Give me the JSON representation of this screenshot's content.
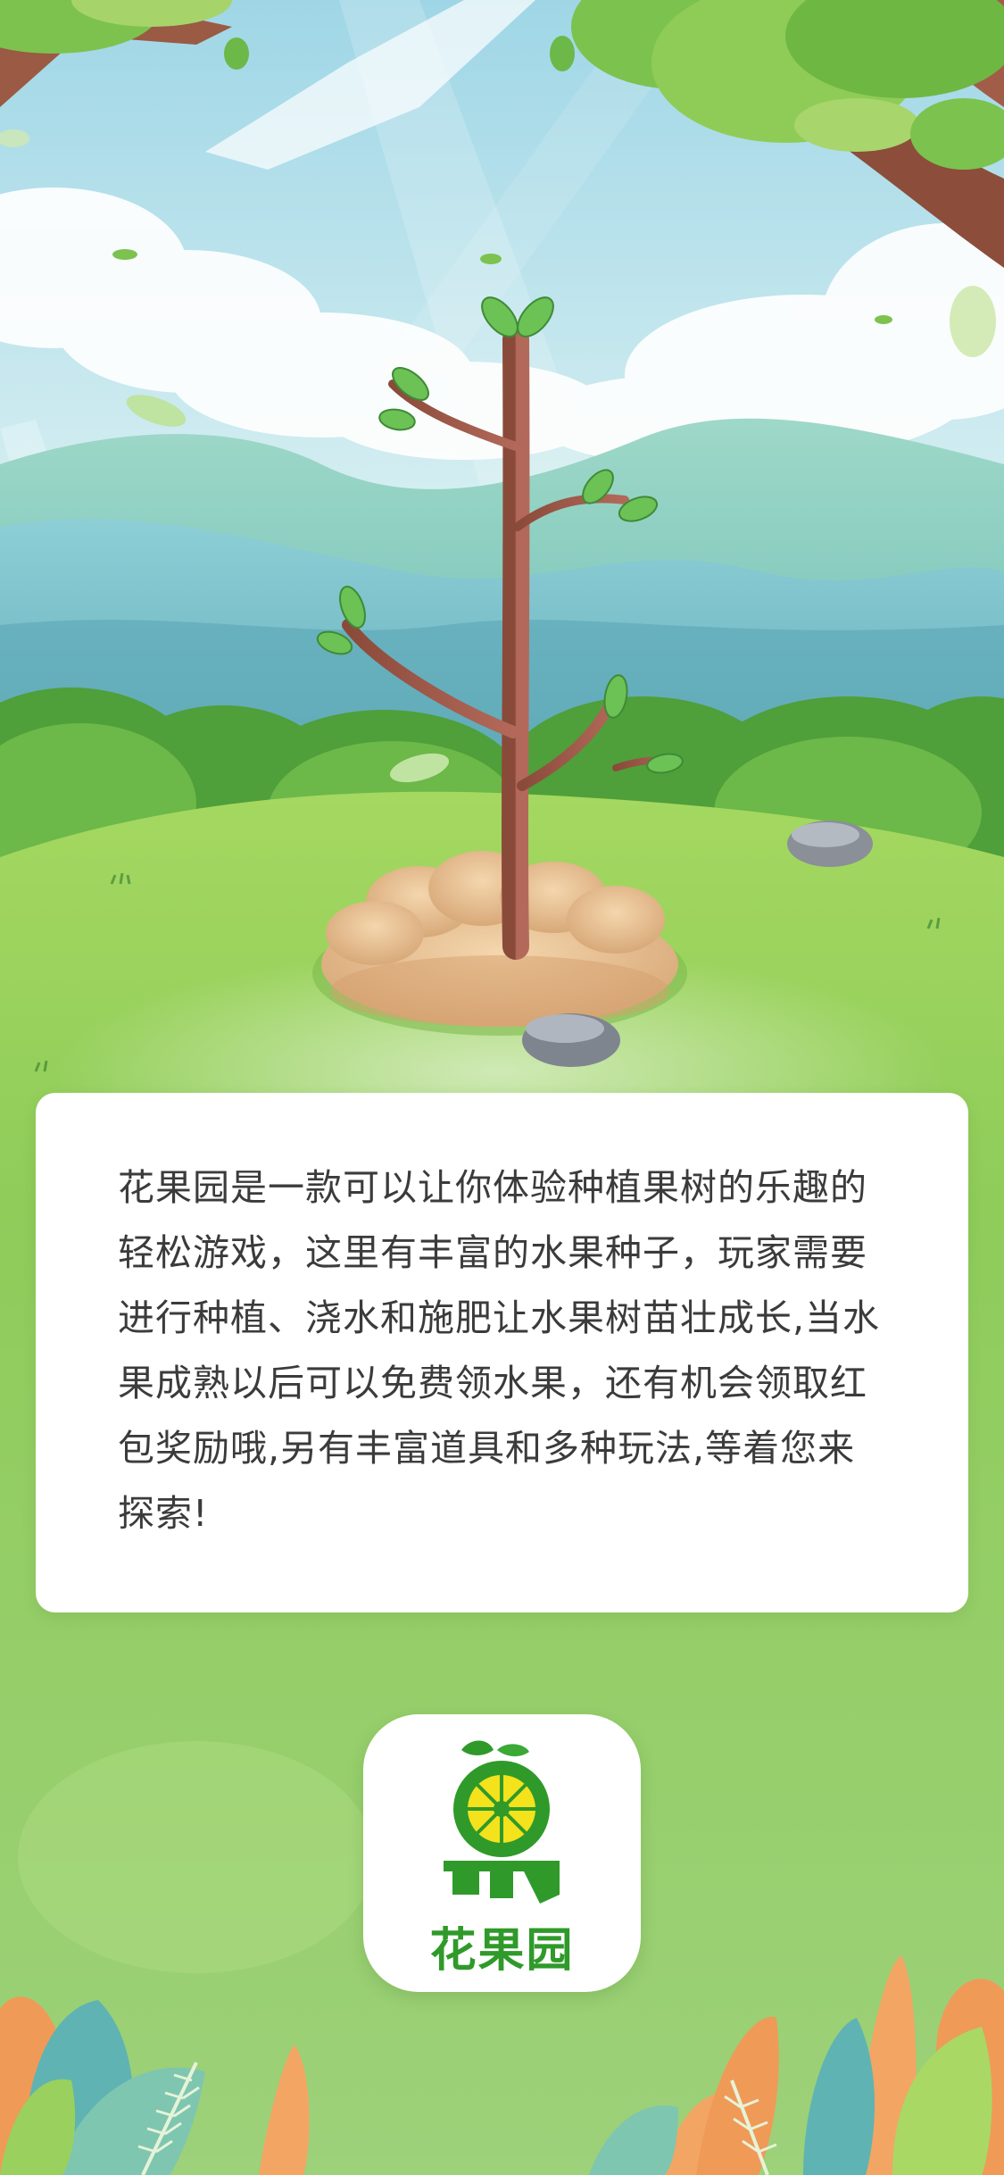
{
  "intro": {
    "text": "花果园是一款可以让你体验种植果树的乐趣的轻松游戏，这里有丰富的水果种子，玩家需要进行种植、浇水和施肥让水果树苗壮成长,当水果成熟以后可以免费领水果，还有机会领取红包奖励哦,另有丰富道具和多种玩法,等着您来探索!"
  },
  "app": {
    "name": "花果园",
    "brand_color": "#2f9a2a",
    "logo_icon": "fruit-logo-icon"
  },
  "colors": {
    "sky": "#bfe6ee",
    "grass": "#9fd27a",
    "card": "#ffffff",
    "text": "#3b3b3b"
  }
}
